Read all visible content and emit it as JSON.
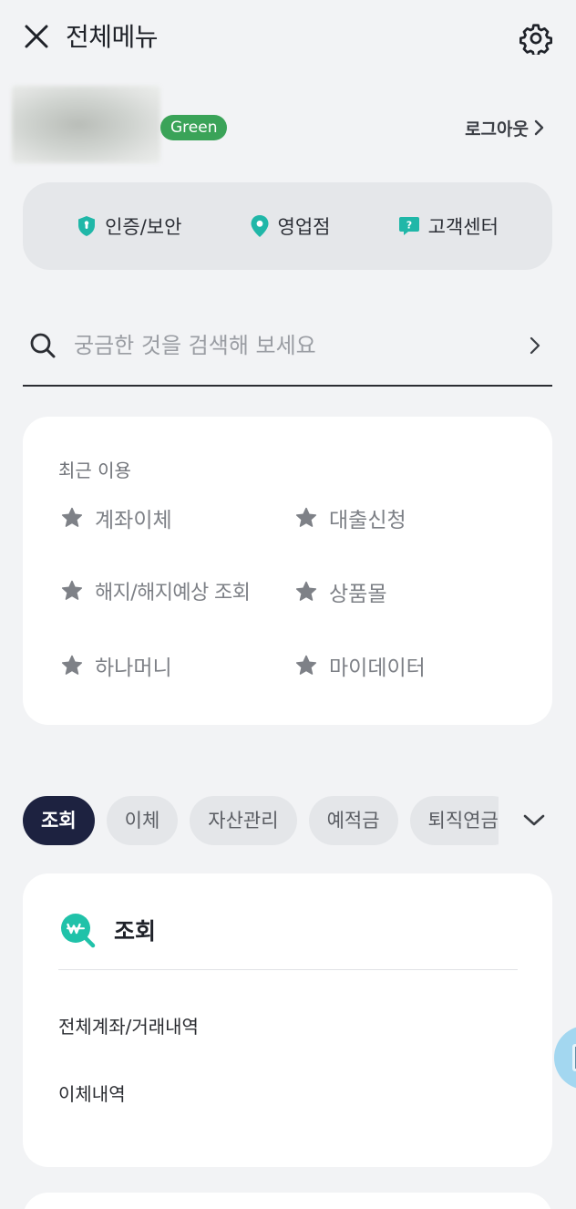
{
  "header": {
    "title": "전체메뉴",
    "close_icon": "close-icon",
    "settings_icon": "gear-icon"
  },
  "profile": {
    "grade_badge": "Green",
    "logout_label": "로그아웃",
    "logout_chevron": "›"
  },
  "quick_menu": [
    {
      "label": "인증/보안",
      "icon": "shield-icon"
    },
    {
      "label": "영업점",
      "icon": "location-pin-icon"
    },
    {
      "label": "고객센터",
      "icon": "help-chat-icon"
    }
  ],
  "search": {
    "placeholder": "궁금한 것을 검색해 보세요"
  },
  "recent": {
    "title": "최근 이용",
    "items": [
      {
        "label": "계좌이체"
      },
      {
        "label": "대출신청"
      },
      {
        "label": "해지/해지예상 조회"
      },
      {
        "label": "상품몰"
      },
      {
        "label": "하나머니"
      },
      {
        "label": "마이데이터"
      }
    ]
  },
  "tabs": {
    "items": [
      {
        "label": "조회",
        "active": true
      },
      {
        "label": "이체",
        "active": false
      },
      {
        "label": "자산관리",
        "active": false
      },
      {
        "label": "예적금",
        "active": false
      },
      {
        "label": "퇴직연금",
        "active": false
      }
    ]
  },
  "inquiry": {
    "title": "조회",
    "icon": "won-search-icon",
    "items": [
      {
        "label": "전체계좌/거래내역"
      },
      {
        "label": "이체내역"
      }
    ]
  },
  "colors": {
    "brand_teal": "#20b7a8",
    "badge_green": "#3aa358",
    "tab_active": "#1d2240",
    "background": "#f2f3f5"
  }
}
